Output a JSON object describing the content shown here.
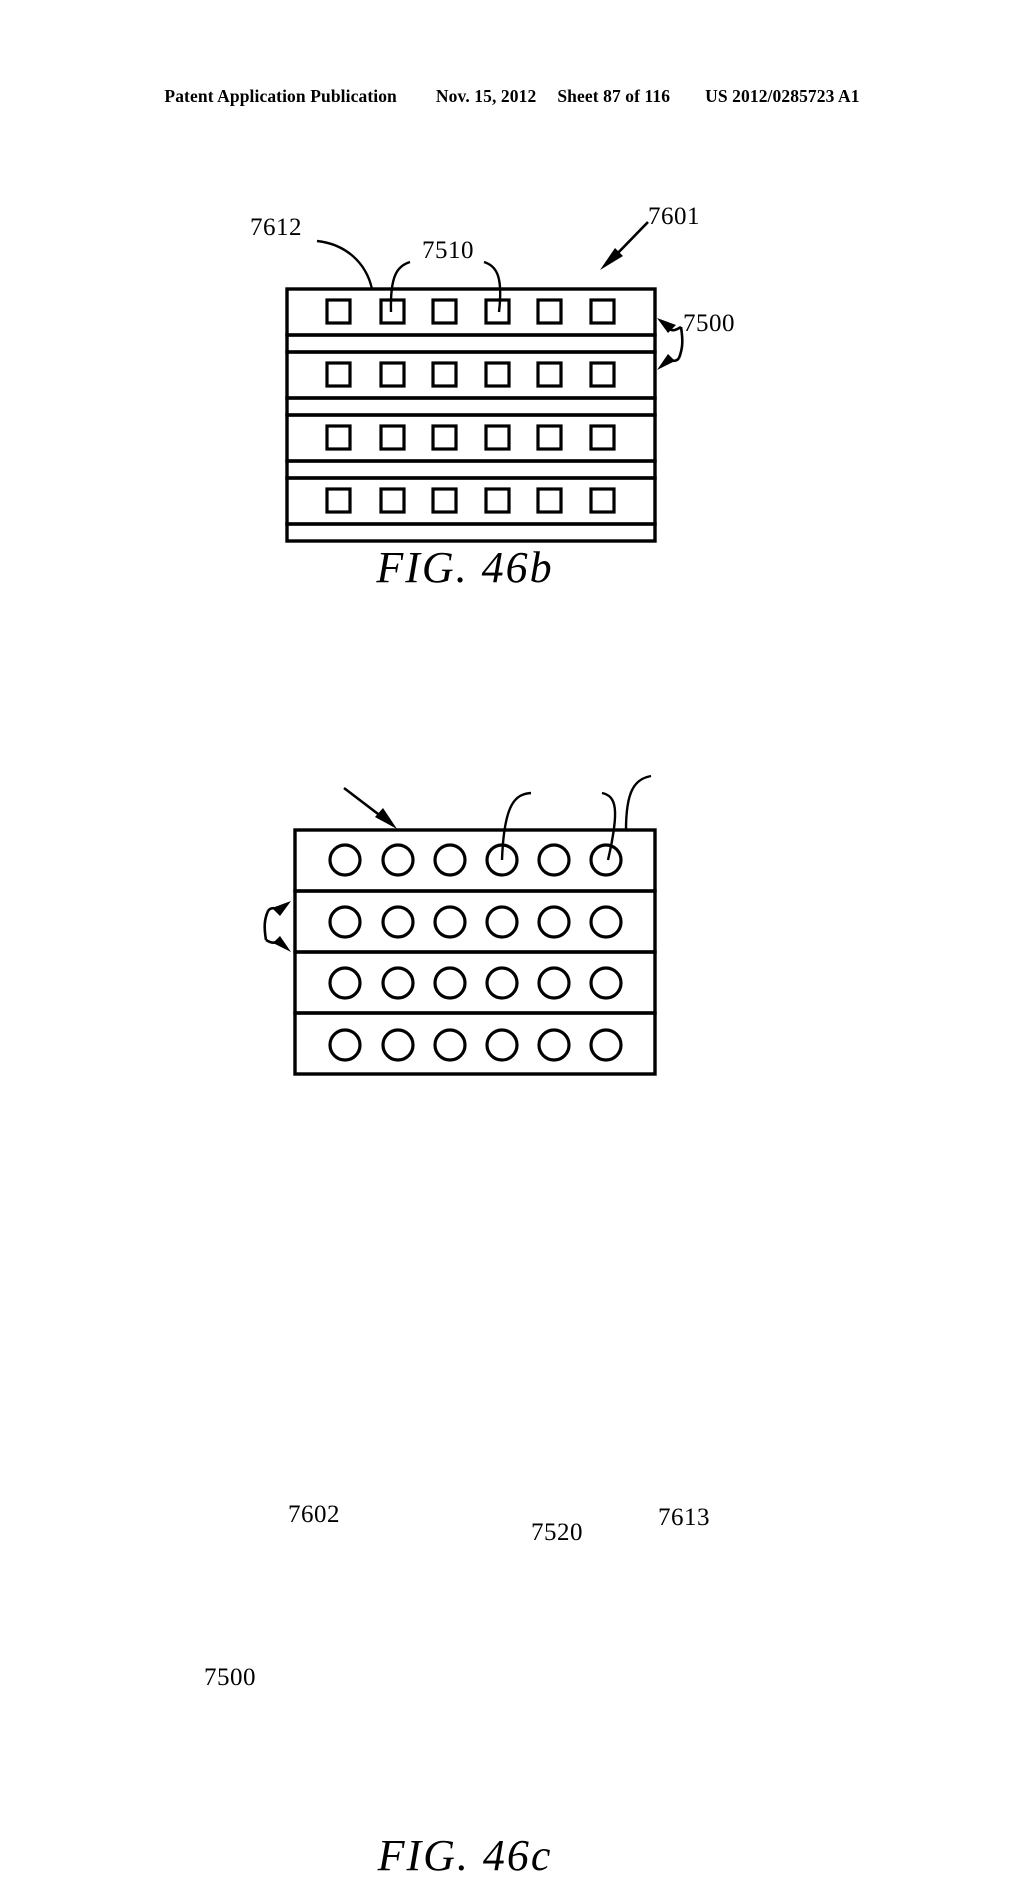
{
  "header": {
    "publication": "Patent Application Publication",
    "date": "Nov. 15, 2012",
    "sheet": "Sheet 87 of 116",
    "docket": "US 2012/0285723 A1"
  },
  "figures": [
    {
      "id": "fig-46b",
      "caption": "FIG. 46b",
      "assembly_ref": "7601",
      "labels": {
        "layer_ref": "7612",
        "element_ref": "7510",
        "stack_ref": "7500"
      },
      "structure": {
        "rows": 4,
        "columns": 6,
        "element_shape": "square",
        "separator_bands": 4,
        "note": "four element layers with thin interlayer bands"
      }
    },
    {
      "id": "fig-46c",
      "caption": "FIG. 46c",
      "assembly_ref": "7602",
      "labels": {
        "layer_ref": "7613",
        "element_ref": "7520",
        "stack_ref": "7500"
      },
      "structure": {
        "rows": 4,
        "columns": 6,
        "element_shape": "circle",
        "separator_bands": 0,
        "note": "four element layers divided by single rules"
      }
    }
  ]
}
